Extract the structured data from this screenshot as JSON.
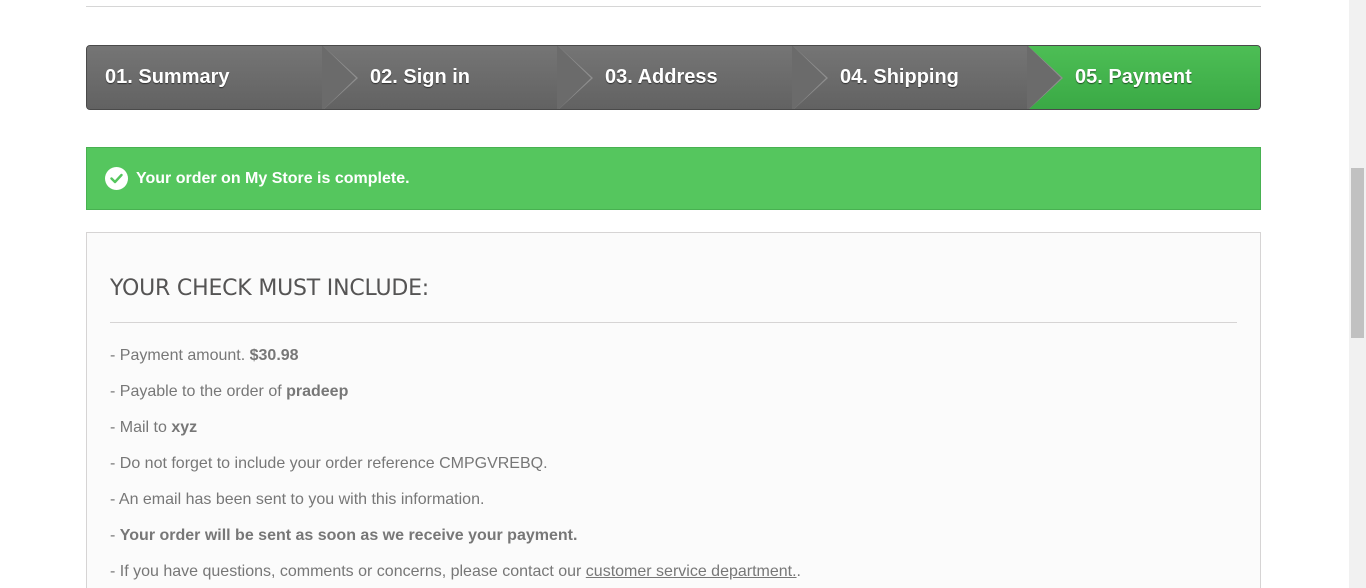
{
  "steps": [
    {
      "label": "01. Summary"
    },
    {
      "label": "02. Sign in"
    },
    {
      "label": "03. Address"
    },
    {
      "label": "04. Shipping"
    },
    {
      "label": "05. Payment"
    }
  ],
  "alert": {
    "icon": "check-circle-icon",
    "text": "Your order on My Store is complete."
  },
  "check_box": {
    "heading": "YOUR CHECK MUST INCLUDE:",
    "amount_prefix": "- Payment amount. ",
    "amount": "$30.98",
    "payable_prefix": "- Payable to the order of ",
    "payable_to": "pradeep",
    "mail_prefix": "- Mail to ",
    "mail_to": "xyz",
    "reference_line": "- Do not forget to include your order reference CMPGVREBQ.",
    "email_line": "- An email has been sent to you with this information.",
    "send_prefix": "- ",
    "send_line": "Your order will be sent as soon as we receive your payment.",
    "contact_prefix": "- If you have questions, comments or concerns, please contact our ",
    "contact_link": "customer service department.",
    "contact_suffix": "."
  },
  "colors": {
    "active_step": "#45b34f",
    "alert_bg": "#55c65e",
    "step_bg": "#6b6b6b"
  }
}
